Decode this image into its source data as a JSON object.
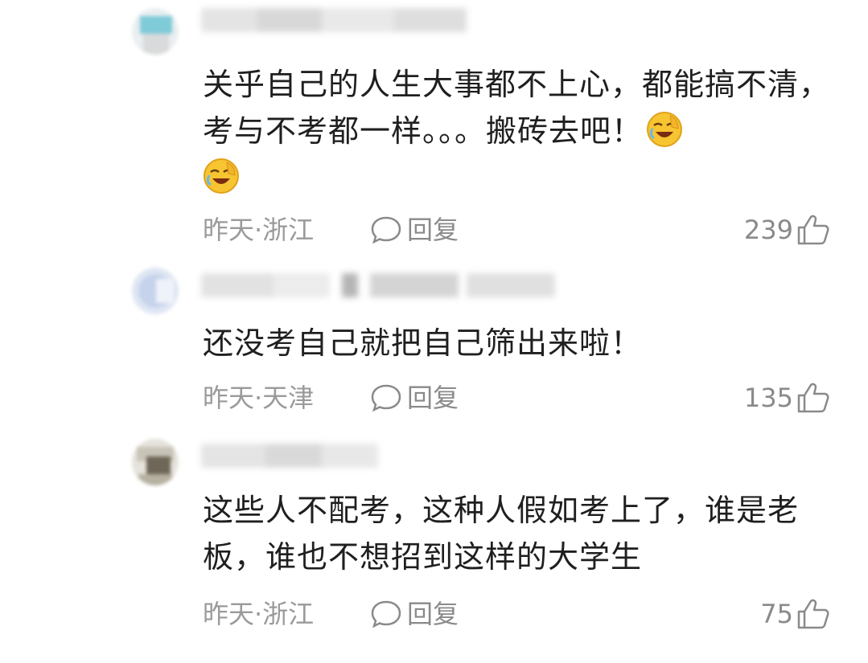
{
  "comments": [
    {
      "text_parts": [
        "关乎自己的人生大事都不上心，都能搞不清，考与不考都一样。。。搬砖去吧！"
      ],
      "emojis": [
        "facepalm-laugh-emoji",
        "facepalm-laugh-emoji"
      ],
      "time": "昨天·浙江",
      "reply_label": "回复",
      "likes": "239"
    },
    {
      "text_parts": [
        "还没考自己就把自己筛出来啦！"
      ],
      "time": "昨天·天津",
      "reply_label": "回复",
      "likes": "135"
    },
    {
      "text_parts": [
        "这些人不配考，这种人假如考上了，谁是老板，谁也不想招到这样的大学生"
      ],
      "time": "昨天·浙江",
      "reply_label": "回复",
      "likes": "75"
    }
  ],
  "colors": {
    "text": "#1f1f1f",
    "meta": "#9a9a9a",
    "background": "#ffffff"
  }
}
